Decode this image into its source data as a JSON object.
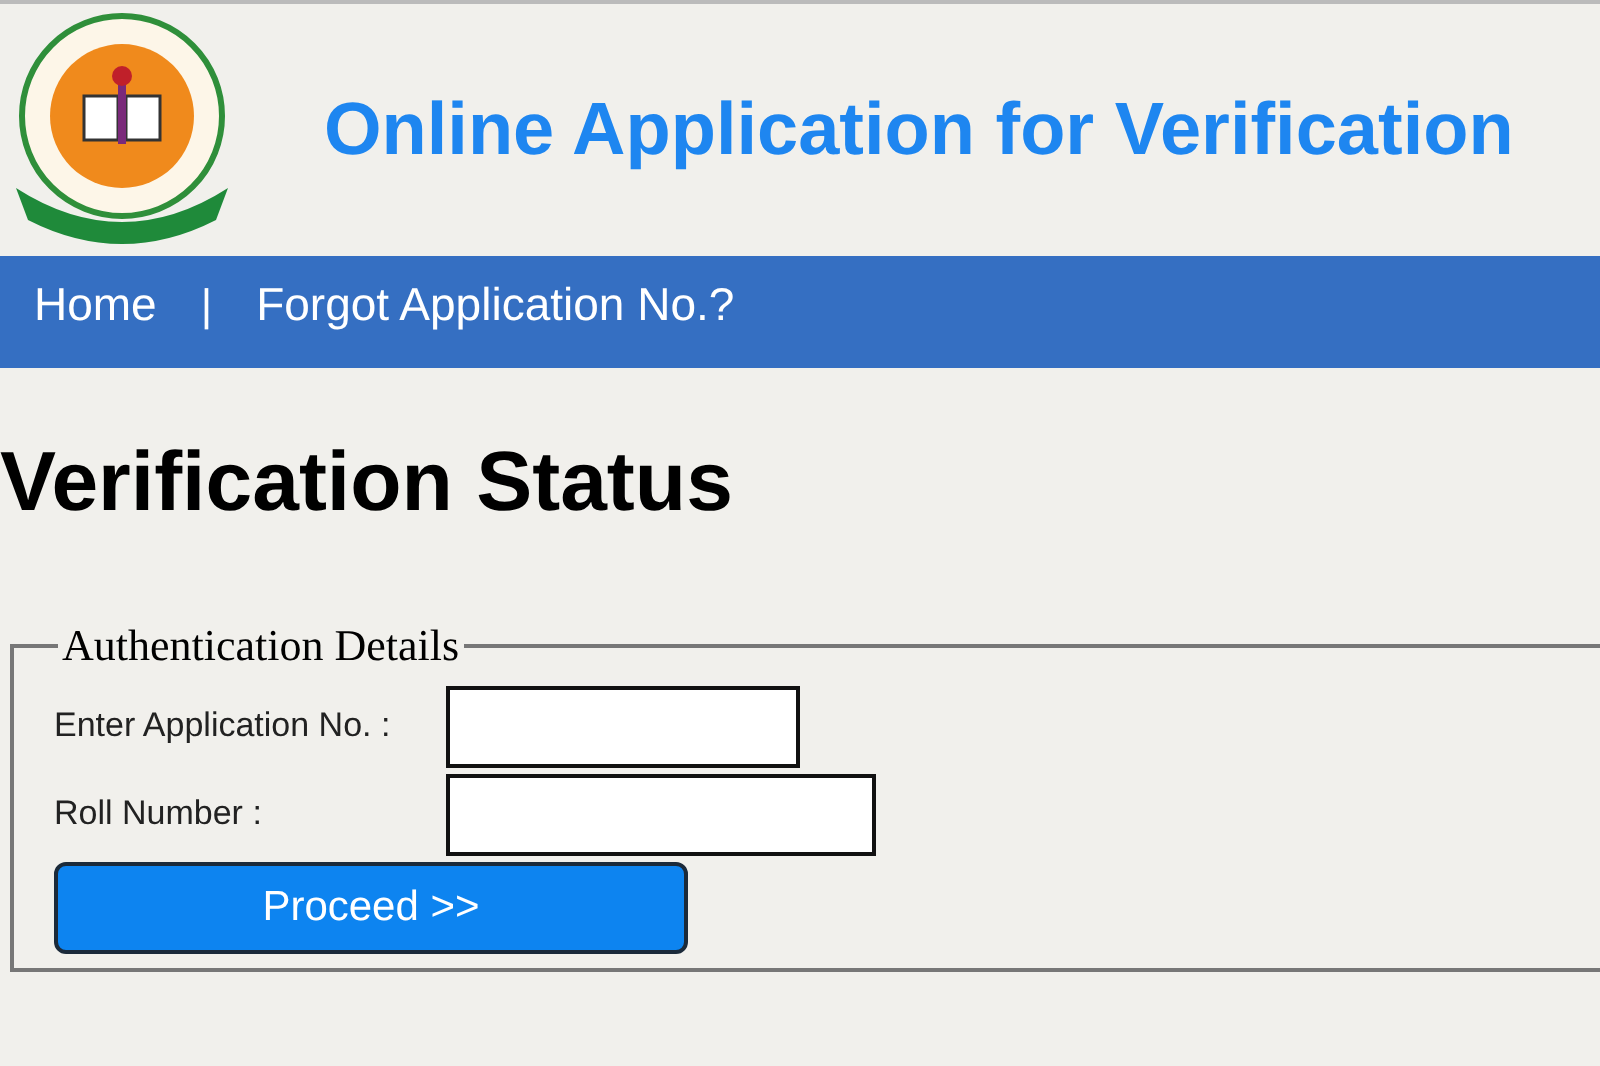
{
  "header": {
    "title": "Online Application for Verification"
  },
  "nav": {
    "items": [
      {
        "label": "Home"
      },
      {
        "label": "Forgot Application No.?"
      }
    ],
    "separator": "|"
  },
  "page_title": "Verification Status",
  "form": {
    "legend": "Authentication Details",
    "fields": [
      {
        "label": "Enter Application No. :"
      },
      {
        "label": "Roll Number :"
      }
    ],
    "button": "Proceed >>"
  }
}
